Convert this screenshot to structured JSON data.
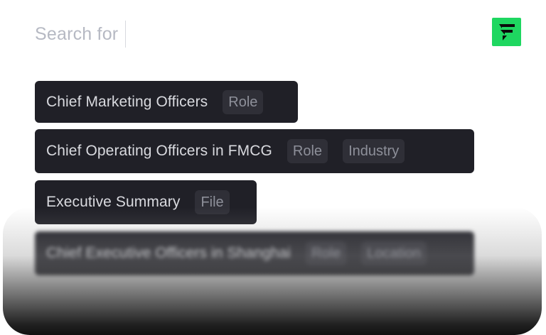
{
  "search": {
    "placeholder": "Search for"
  },
  "logo": {
    "icon": "brand-logo-icon",
    "color": "#1ed760"
  },
  "suggestions": [
    {
      "label": "Chief Marketing Officers",
      "tags": [
        "Role"
      ]
    },
    {
      "label": "Chief Operating Officers in FMCG",
      "tags": [
        "Role",
        "Industry"
      ]
    },
    {
      "label": "Executive Summary",
      "tags": [
        "File"
      ]
    },
    {
      "label": "Chief Executive Officers in Shanghai",
      "tags": [
        "Role",
        "Location"
      ]
    }
  ],
  "colors": {
    "chip_bg": "#202027",
    "tag_bg": "#2f2f37",
    "placeholder": "#b6b9c3",
    "accent": "#1ed760"
  }
}
